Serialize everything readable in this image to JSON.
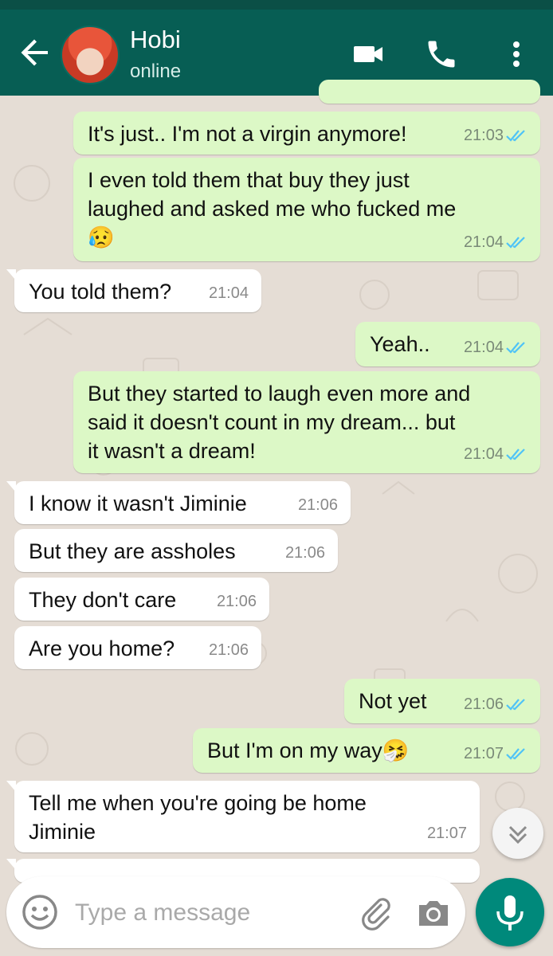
{
  "header": {
    "contact_name": "Hobi",
    "contact_status": "online"
  },
  "messages": [
    {
      "id": "m1",
      "direction": "out",
      "text": "It's just.. I'm not a virgin anymore!",
      "time": "21:03",
      "status": "read"
    },
    {
      "id": "m2",
      "direction": "out",
      "text": "I even told them that buy they just\nlaughed and asked me who fucked me\n😥",
      "time": "21:04",
      "status": "read"
    },
    {
      "id": "m3",
      "direction": "in",
      "text": "You told them?",
      "time": "21:04"
    },
    {
      "id": "m4",
      "direction": "out",
      "text": "Yeah..",
      "time": "21:04",
      "status": "read"
    },
    {
      "id": "m5",
      "direction": "out",
      "text": "But they started to laugh even more and\nsaid it doesn't count in my dream... but\nit wasn't a dream!",
      "time": "21:04",
      "status": "read"
    },
    {
      "id": "m6",
      "direction": "in",
      "text": "I know it wasn't Jiminie",
      "time": "21:06"
    },
    {
      "id": "m7",
      "direction": "in",
      "text": "But they are assholes",
      "time": "21:06"
    },
    {
      "id": "m8",
      "direction": "in",
      "text": "They don't care",
      "time": "21:06"
    },
    {
      "id": "m9",
      "direction": "in",
      "text": "Are you home?",
      "time": "21:06"
    },
    {
      "id": "m10",
      "direction": "out",
      "text": "Not yet",
      "time": "21:06",
      "status": "read"
    },
    {
      "id": "m11",
      "direction": "out",
      "text": "But I'm on my way🤧",
      "time": "21:07",
      "status": "read"
    },
    {
      "id": "m12",
      "direction": "in",
      "text": "Tell me when you're going be home\nJiminie",
      "time": "21:07"
    }
  ],
  "composer": {
    "placeholder": "Type a message"
  },
  "colors": {
    "header": "#075e54",
    "outgoing_bubble": "#dcf8c6",
    "incoming_bubble": "#ffffff",
    "read_ticks": "#4fc3f7",
    "mic_button": "#00897b",
    "wallpaper": "#e5ddd5"
  },
  "icons": [
    "back-arrow-icon",
    "video-call-icon",
    "phone-icon",
    "more-vert-icon",
    "emoji-icon",
    "attach-icon",
    "camera-icon",
    "mic-icon",
    "chevron-down-icon",
    "double-check-icon"
  ]
}
